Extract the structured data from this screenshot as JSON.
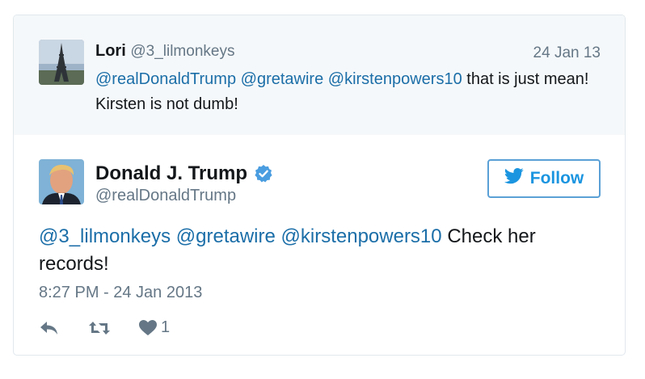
{
  "reply": {
    "name": "Lori",
    "handle": "@3_lilmonkeys",
    "date": "24 Jan 13",
    "mentions": [
      "@realDonaldTrump",
      "@gretawire",
      "@kirstenpowers10"
    ],
    "text": "that is just mean! Kirsten is not dumb!",
    "avatar_icon": "eiffel-tower-photo"
  },
  "tweet": {
    "name": "Donald J. Trump",
    "handle": "@realDonaldTrump",
    "verified_icon": "verified-badge-icon",
    "follow_label": "Follow",
    "mentions": [
      "@3_lilmonkeys",
      "@gretawire",
      "@kirstenpowers10"
    ],
    "text": "Check her records!",
    "timestamp": "8:27 PM - 24 Jan 2013",
    "like_count": "1"
  },
  "colors": {
    "link": "#1b6ea8",
    "follow_border": "#5aa0d6",
    "reply_bg": "#f5f8fa",
    "muted": "#657786"
  }
}
